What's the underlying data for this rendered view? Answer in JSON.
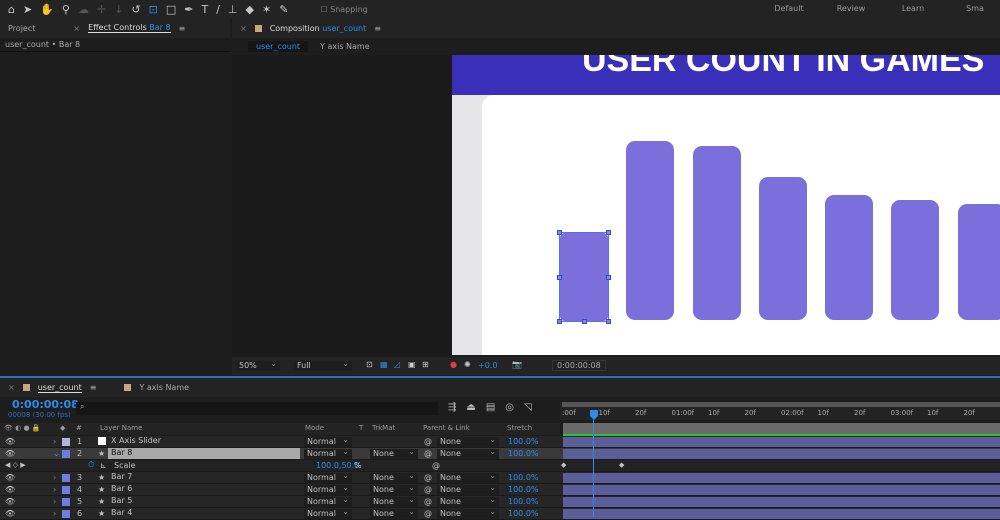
{
  "toolbar": {
    "icons": [
      "home-icon",
      "selection-icon",
      "hand-icon",
      "zoom-icon",
      "orbit-icon",
      "pan-icon",
      "dolly-icon",
      "rotate-icon",
      "anchor-icon",
      "rectangle-icon",
      "pen-icon",
      "type-icon",
      "brush-icon",
      "stamp-icon",
      "eraser-icon",
      "puppet-icon",
      "pin-icon"
    ],
    "snapping": "Snapping",
    "workspaces": [
      "Default",
      "Review",
      "Learn",
      "Sma"
    ]
  },
  "left_panel": {
    "project_tab": "Project",
    "effect_tab": "Effect Controls",
    "effect_layer": "Bar 8",
    "subtitle": "user_count • Bar 8"
  },
  "comp_panel": {
    "tab": "Composition",
    "comp_name": "user_count",
    "breadcrumb": [
      "user_count",
      "Y axis Name"
    ],
    "title_text": "USER COUNT IN GAMES",
    "zoom": "50%",
    "resolution": "Full",
    "exposure": "+0.0",
    "timecode": "0:00:00:08",
    "bar_color": "#7b6fdb",
    "header_color": "#3a2fb8"
  },
  "timeline": {
    "tabs": [
      "user_count",
      "Y axis Name"
    ],
    "timecode": "0:00:00:08",
    "frame_info": "00008 (30.00 fps)",
    "columns": {
      "num": "#",
      "layer_name": "Layer Name",
      "mode": "Mode",
      "t": "T",
      "trkmat": "TrkMat",
      "parent": "Parent & Link",
      "stretch": "Stretch"
    },
    "ruler": [
      ":00f",
      "10f",
      "20f",
      "01:00f",
      "10f",
      "20f",
      "02:00f",
      "10f",
      "20f",
      "03:00f",
      "10f",
      "20f",
      "04"
    ],
    "layers": [
      {
        "num": "1",
        "name": "X Axis Slider",
        "mode": "Normal",
        "trkmat": "",
        "parent": "None",
        "stretch": "100.0%",
        "color": "#b4b4dc"
      },
      {
        "num": "2",
        "name": "Bar 8",
        "mode": "Normal",
        "trkmat": "None",
        "parent": "None",
        "stretch": "100.0%",
        "color": "#6a7de0",
        "selected": true
      },
      {
        "num": "3",
        "name": "Bar 7",
        "mode": "Normal",
        "trkmat": "None",
        "parent": "None",
        "stretch": "100.0%",
        "color": "#6a7de0"
      },
      {
        "num": "4",
        "name": "Bar 6",
        "mode": "Normal",
        "trkmat": "None",
        "parent": "None",
        "stretch": "100.0%",
        "color": "#6a7de0"
      },
      {
        "num": "5",
        "name": "Bar 5",
        "mode": "Normal",
        "trkmat": "None",
        "parent": "None",
        "stretch": "100.0%",
        "color": "#6a7de0"
      },
      {
        "num": "6",
        "name": "Bar 4",
        "mode": "Normal",
        "trkmat": "None",
        "parent": "None",
        "stretch": "100.0%",
        "color": "#6a7de0"
      }
    ],
    "property": {
      "name": "Scale",
      "value": "100.0,50.0",
      "unit": "%"
    }
  }
}
